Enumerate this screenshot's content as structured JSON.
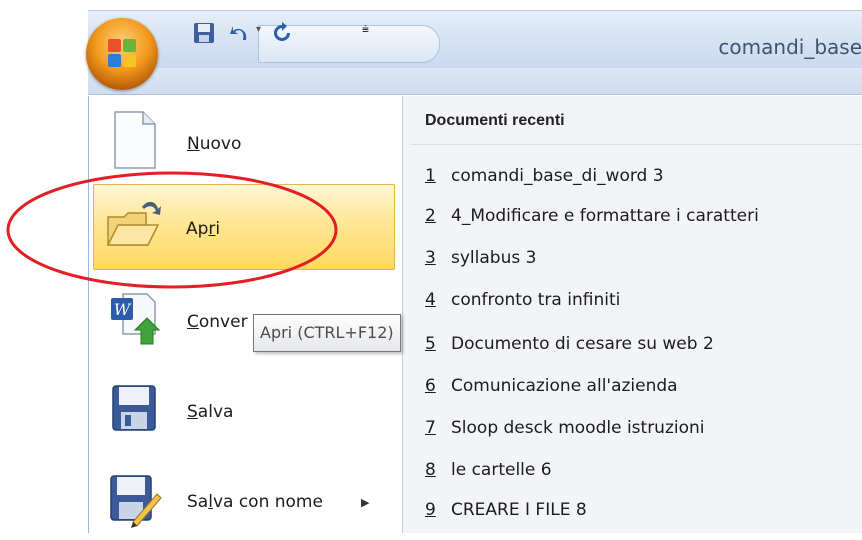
{
  "title_bar": {
    "document_title": "comandi_base"
  },
  "menu": {
    "items": [
      {
        "label": "Nuovo",
        "mnemonic": "N",
        "rest": "uovo",
        "icon": "new-document-icon"
      },
      {
        "label": "Apri",
        "pre": "Ap",
        "mnemonic": "r",
        "rest": "i",
        "icon": "open-folder-icon"
      },
      {
        "label": "Conver",
        "mnemonic": "C",
        "rest": "onver",
        "icon": "convert-icon"
      },
      {
        "label": "Salva",
        "mnemonic": "S",
        "rest": "alva",
        "icon": "save-icon"
      },
      {
        "label": "Salva con nome",
        "pre": "Sa",
        "mnemonic": "l",
        "rest": "va con nome",
        "icon": "save-as-icon"
      }
    ]
  },
  "recent": {
    "header": "Documenti recenti",
    "items": [
      {
        "num": "1",
        "name": "comandi_base_di_word 3"
      },
      {
        "num": "2",
        "name": "4_Modificare e formattare i caratteri"
      },
      {
        "num": "3",
        "name": "syllabus 3"
      },
      {
        "num": "4",
        "name": "confronto tra infiniti"
      },
      {
        "num": "5",
        "name": "Documento di cesare su web 2"
      },
      {
        "num": "6",
        "name": "Comunicazione all'azienda"
      },
      {
        "num": "7",
        "name": "Sloop desck moodle istruzioni"
      },
      {
        "num": "8",
        "name": "le cartelle 6"
      },
      {
        "num": "9",
        "name": "CREARE I FILE 8"
      }
    ]
  },
  "tooltip": {
    "text": "Apri (CTRL+F12)"
  },
  "colors": {
    "highlight": "#ffd85f",
    "annotation": "#e31e24",
    "title_text": "#3f5471"
  }
}
